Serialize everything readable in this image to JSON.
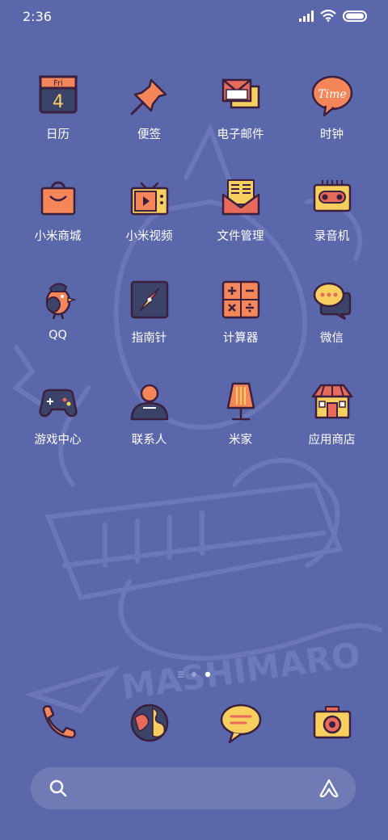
{
  "status_bar": {
    "time": "2:36"
  },
  "apps": [
    {
      "label": "日历",
      "icon": "calendar-icon",
      "weekday": "Fri",
      "day": "4"
    },
    {
      "label": "便签",
      "icon": "pushpin-icon"
    },
    {
      "label": "电子邮件",
      "icon": "envelope-icon"
    },
    {
      "label": "时钟",
      "icon": "clock-bubble-icon",
      "icon_text": "Time"
    },
    {
      "label": "小米商城",
      "icon": "shopping-bag-icon"
    },
    {
      "label": "小米视频",
      "icon": "tv-icon"
    },
    {
      "label": "文件管理",
      "icon": "file-envelope-icon"
    },
    {
      "label": "录音机",
      "icon": "cassette-icon"
    },
    {
      "label": "QQ",
      "icon": "bird-character-icon"
    },
    {
      "label": "指南针",
      "icon": "compass-icon"
    },
    {
      "label": "计算器",
      "icon": "calculator-icon"
    },
    {
      "label": "微信",
      "icon": "chat-bubbles-icon"
    },
    {
      "label": "游戏中心",
      "icon": "gamepad-icon"
    },
    {
      "label": "联系人",
      "icon": "person-icon"
    },
    {
      "label": "米家",
      "icon": "lamp-icon"
    },
    {
      "label": "应用商店",
      "icon": "store-icon"
    }
  ],
  "dock": [
    {
      "name": "phone",
      "icon": "phone-icon"
    },
    {
      "name": "browser",
      "icon": "globe-icon"
    },
    {
      "name": "messages",
      "icon": "message-bubble-icon"
    },
    {
      "name": "camera",
      "icon": "camera-icon"
    }
  ],
  "colors": {
    "background": "#5b67ab",
    "outline": "#3b1f3e",
    "orange": "#f4865a",
    "yellow": "#f7cf5f",
    "navy": "#3b4468",
    "pink": "#e86a5a"
  },
  "pages": {
    "count": 3,
    "current": 3
  }
}
